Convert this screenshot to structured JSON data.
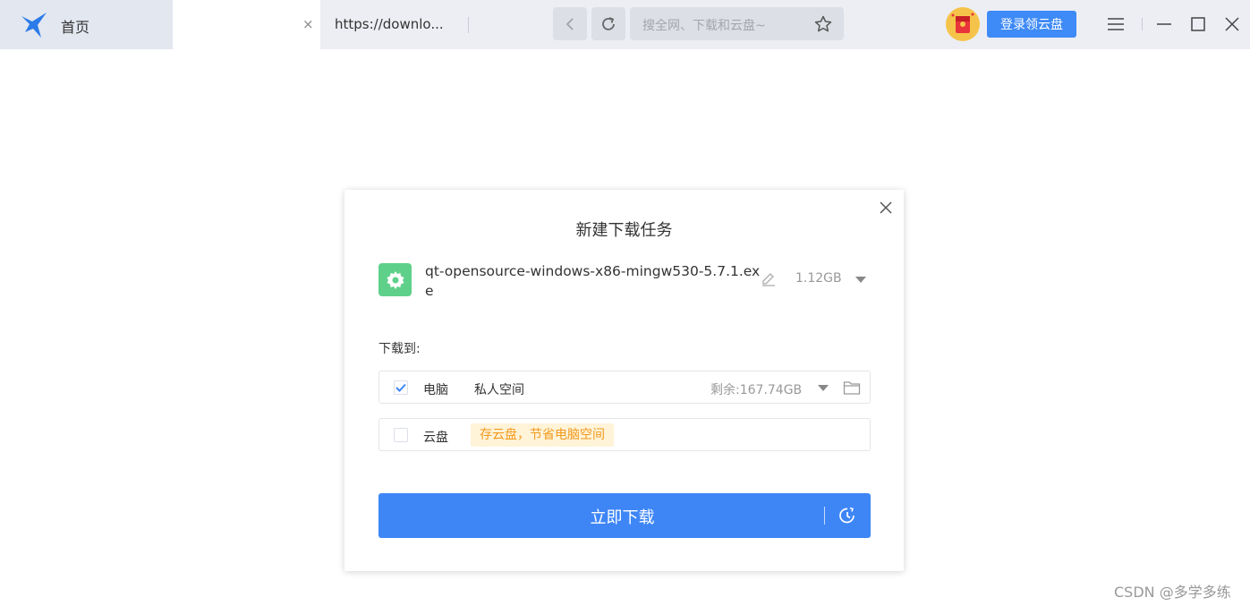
{
  "tabs": {
    "home_label": "首页",
    "blank_close": "×",
    "url_label": "https://downlo..."
  },
  "search": {
    "placeholder": "搜全网、下载和云盘~"
  },
  "header": {
    "login_label": "登录领云盘"
  },
  "dialog": {
    "title": "新建下载任务",
    "file_name": "qt-opensource-windows-x86-mingw530-5.7.1.exe",
    "file_size": "1.12GB",
    "save_to_label": "下载到:",
    "pc_row": {
      "label": "电脑",
      "space": "私人空间",
      "free": "剩余:167.74GB",
      "checked": true
    },
    "cloud_row": {
      "label": "云盘",
      "promo": "存云盘，节省电脑空间",
      "checked": false
    },
    "download_label": "立即下载"
  },
  "watermark": "CSDN @多学多练",
  "colors": {
    "accent": "#3e86f6",
    "file_icon": "#5fd08a",
    "promo_bg": "#fff3d8",
    "promo_text": "#f29a1d"
  },
  "icons": [
    "bird-logo-icon",
    "close-icon",
    "back-icon",
    "refresh-icon",
    "star-icon",
    "gift-icon",
    "menu-icon",
    "minimize-icon",
    "maximize-icon",
    "gear-icon",
    "edit-icon",
    "caret-down-icon",
    "folder-icon",
    "check-icon",
    "clock-icon"
  ]
}
